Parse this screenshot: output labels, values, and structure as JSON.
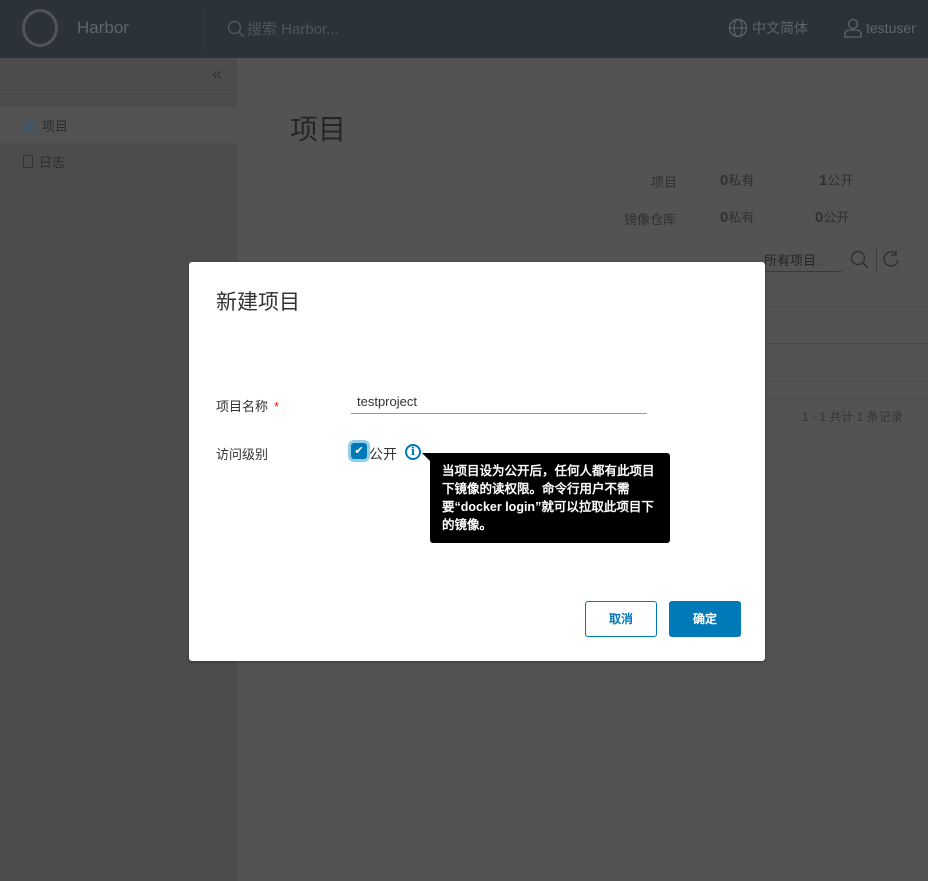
{
  "header": {
    "brand": "Harbor",
    "search_placeholder": "搜索 Harbor...",
    "language": "中文简体",
    "user": "testuser"
  },
  "sidebar": {
    "collapse": "«",
    "items": [
      {
        "label": "项目",
        "icon": "projects-icon"
      },
      {
        "label": "日志",
        "icon": "logs-icon"
      }
    ]
  },
  "main": {
    "title": "项目",
    "stats": {
      "row1_label": "项目",
      "row1_private": "0",
      "row1_public": "1",
      "row2_label": "镜像仓库",
      "row2_private": "0",
      "row2_public": "0",
      "private_label": "私有",
      "public_label": "公开"
    },
    "filter": "所有项目",
    "pager": "1 - 1 共计 1 条记录"
  },
  "modal": {
    "title": "新建项目",
    "name_label": "项目名称",
    "required_mark": "*",
    "name_value": "testproject",
    "access_label": "访问级别",
    "public_label": "公开",
    "public_checked": true,
    "tooltip": "当项目设为公开后，任何人都有此项目下镜像的读权限。命令行用户不需要“docker login”就可以拉取此项目下的镜像。",
    "cancel": "取消",
    "ok": "确定"
  }
}
